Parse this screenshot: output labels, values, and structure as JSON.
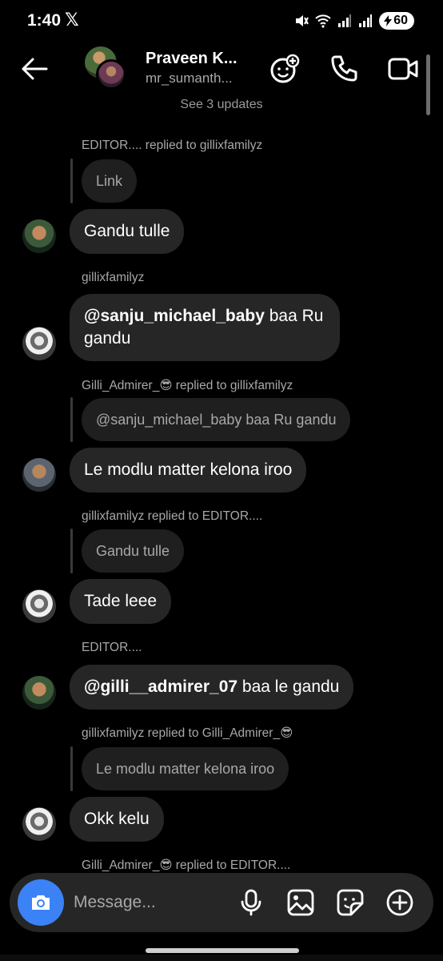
{
  "status_bar": {
    "time": "1:40",
    "x_logo": "𝕏",
    "battery": "60"
  },
  "header": {
    "name": "Praveen K...",
    "handle": "mr_sumanth...",
    "see_updates": "See 3 updates"
  },
  "messages": [
    {
      "meta": "EDITOR.... replied to gillixfamilyz",
      "quote": "Link",
      "text": "Gandu tulle"
    },
    {
      "meta": "gillixfamilyz",
      "mention": "@sanju_michael_baby",
      "text": " baa Ru gandu"
    },
    {
      "meta": "Gilli_Admirer_😎 replied to gillixfamilyz",
      "quote": "@sanju_michael_baby baa Ru gandu",
      "text": "Le modlu matter kelona iroo"
    },
    {
      "meta": "gillixfamilyz replied to EDITOR....",
      "quote": "Gandu tulle",
      "text": "Tade leee"
    },
    {
      "meta": "EDITOR....",
      "mention": "@gilli__admirer_07",
      "text": " baa le gandu"
    },
    {
      "meta": "gillixfamilyz replied to Gilli_Admirer_😎",
      "quote": "Le modlu matter kelona iroo",
      "text": "Okk kelu"
    },
    {
      "meta": "Gilli_Admirer_😎 replied to EDITOR...."
    }
  ],
  "composer": {
    "placeholder": "Message..."
  },
  "icons": {
    "back": "arrow-left-icon",
    "effects": "face-plus-icon",
    "call": "phone-icon",
    "video": "video-camera-icon",
    "camera": "camera-icon",
    "mic": "microphone-icon",
    "gallery": "image-icon",
    "sticker": "sticker-icon",
    "more": "plus-circle-icon"
  },
  "colors": {
    "background": "#000000",
    "bubble": "#262626",
    "quote": "#1f1f1f",
    "accent": "#3b82f6"
  }
}
